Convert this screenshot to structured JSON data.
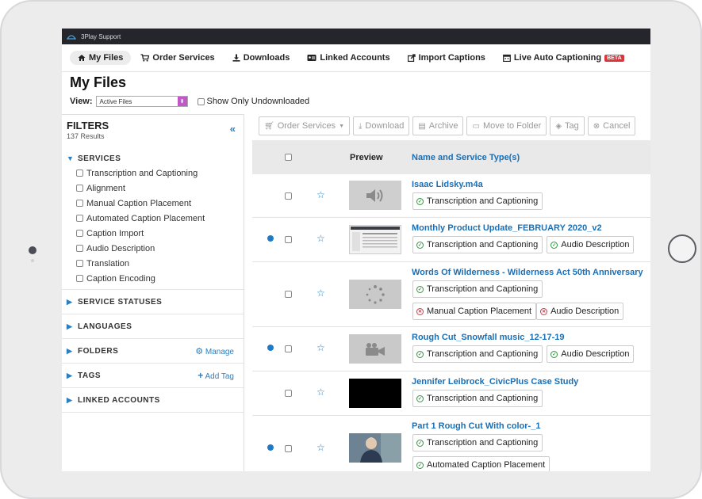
{
  "app": {
    "brand": "3Play Support"
  },
  "nav": [
    {
      "label": "My Files",
      "icon": "home-icon",
      "active": true
    },
    {
      "label": "Order Services",
      "icon": "cart-icon"
    },
    {
      "label": "Downloads",
      "icon": "download-icon"
    },
    {
      "label": "Linked Accounts",
      "icon": "id-card-icon"
    },
    {
      "label": "Import Captions",
      "icon": "import-icon"
    },
    {
      "label": "Live Auto Captioning",
      "icon": "calendar-icon",
      "badge": "BETA"
    }
  ],
  "page": {
    "title": "My Files",
    "view_label": "View:",
    "view_value": "Active Files",
    "undownloaded_label": "Show Only Undownloaded"
  },
  "filters": {
    "title": "FILTERS",
    "count": "137 Results",
    "services_label": "SERVICES",
    "services": [
      "Transcription and Captioning",
      "Alignment",
      "Manual Caption Placement",
      "Automated Caption Placement",
      "Caption Import",
      "Audio Description",
      "Translation",
      "Caption Encoding"
    ],
    "sections": [
      {
        "label": "SERVICE STATUSES",
        "action": ""
      },
      {
        "label": "LANGUAGES",
        "action": ""
      },
      {
        "label": "FOLDERS",
        "action": "Manage",
        "action_icon": "gear-icon"
      },
      {
        "label": "TAGS",
        "action": "Add Tag",
        "action_icon": "plus-icon"
      },
      {
        "label": "LINKED ACCOUNTS",
        "action": ""
      }
    ]
  },
  "toolbar": [
    {
      "label": "Order Services",
      "icon": "cart-icon"
    },
    {
      "label": "Download",
      "icon": "download-icon"
    },
    {
      "label": "Archive",
      "icon": "archive-icon"
    },
    {
      "label": "Move to Folder",
      "icon": "folder-icon"
    },
    {
      "label": "Tag",
      "icon": "tag-icon"
    },
    {
      "label": "Cancel",
      "icon": "cancel-icon"
    }
  ],
  "table": {
    "col_preview": "Preview",
    "col_name": "Name and Service Type(s)",
    "rows": [
      {
        "name": "Isaac Lidsky.m4a",
        "dot": false,
        "thumb": "audio-icon",
        "services": [
          {
            "label": "Transcription and Captioning",
            "status": "ok"
          }
        ]
      },
      {
        "name": "Monthly Product Update_FEBRUARY 2020_v2",
        "dot": true,
        "thumb": "screenshot",
        "services": [
          {
            "label": "Transcription and Captioning",
            "status": "ok"
          },
          {
            "label": "Audio Description",
            "status": "ok"
          }
        ]
      },
      {
        "name": "Words Of Wilderness - Wilderness Act 50th Anniversary",
        "dot": false,
        "thumb": "loading-icon",
        "services": [
          {
            "label": "Transcription and Captioning",
            "status": "ok"
          },
          {
            "label": "Manual Caption Placement",
            "status": "error"
          },
          {
            "label": "Audio Description",
            "status": "error"
          }
        ]
      },
      {
        "name": "Rough Cut_Snowfall music_12-17-19",
        "dot": true,
        "thumb": "video-camera-icon",
        "services": [
          {
            "label": "Transcription and Captioning",
            "status": "ok"
          },
          {
            "label": "Audio Description",
            "status": "ok"
          }
        ]
      },
      {
        "name": "Jennifer Leibrock_CivicPlus Case Study",
        "dot": false,
        "thumb": "black",
        "services": [
          {
            "label": "Transcription and Captioning",
            "status": "ok"
          }
        ]
      },
      {
        "name": "Part 1 Rough Cut With color-_1",
        "dot": true,
        "thumb": "photo",
        "services": [
          {
            "label": "Transcription and Captioning",
            "status": "ok"
          },
          {
            "label": "Automated Caption Placement",
            "status": "ok"
          }
        ]
      }
    ]
  }
}
